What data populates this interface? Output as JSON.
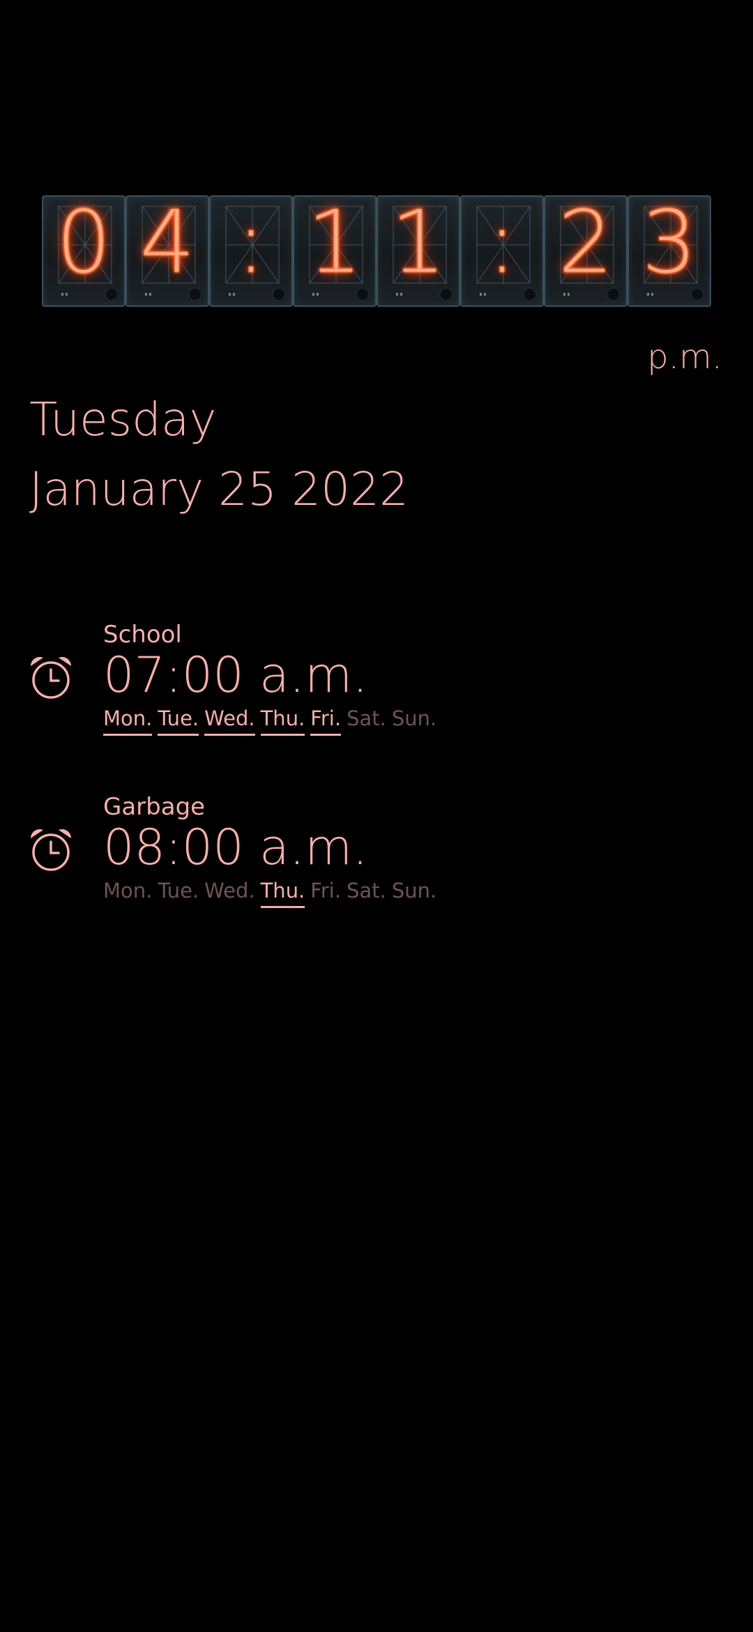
{
  "clock": {
    "digits": [
      "0",
      "4",
      ":",
      "1",
      "1",
      ":",
      "2",
      "3"
    ],
    "meridiem": "p.m.",
    "tube_glow_color": "#ff5a1a"
  },
  "date": {
    "weekday": "Tuesday",
    "full_date": "January 25 2022"
  },
  "alarms": [
    {
      "label": "School",
      "time": "07:00 a.m.",
      "icon": "alarm-clock-icon",
      "days": [
        {
          "label": "Mon.",
          "active": true
        },
        {
          "label": "Tue.",
          "active": true
        },
        {
          "label": "Wed.",
          "active": true
        },
        {
          "label": "Thu.",
          "active": true
        },
        {
          "label": "Fri.",
          "active": true
        },
        {
          "label": "Sat.",
          "active": false
        },
        {
          "label": "Sun.",
          "active": false
        }
      ]
    },
    {
      "label": "Garbage",
      "time": "08:00 a.m.",
      "icon": "alarm-clock-icon",
      "days": [
        {
          "label": "Mon.",
          "active": false
        },
        {
          "label": "Tue.",
          "active": false
        },
        {
          "label": "Wed.",
          "active": false
        },
        {
          "label": "Thu.",
          "active": true
        },
        {
          "label": "Fri.",
          "active": false
        },
        {
          "label": "Sat.",
          "active": false
        },
        {
          "label": "Sun.",
          "active": false
        }
      ]
    }
  ],
  "colors": {
    "text": "#f6b0ab",
    "inactive_day": "#6e5452",
    "background": "#000000"
  }
}
